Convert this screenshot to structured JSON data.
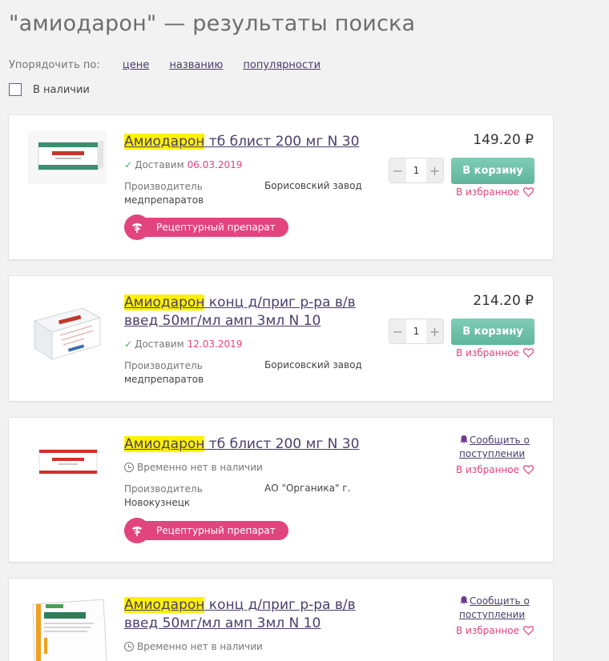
{
  "header": {
    "title": "\"амиодарон\" — результаты поиска"
  },
  "sort": {
    "label": "Упорядочить по:",
    "options": [
      "цене",
      "названию",
      "популярности"
    ]
  },
  "filter": {
    "in_stock_label": "В наличии",
    "in_stock_checked": false
  },
  "colors": {
    "accent": "#e2457e",
    "link": "#4a3d6b",
    "cart_button": "#6cc0a6",
    "highlight": "#fff100"
  },
  "products": [
    {
      "name_highlight": "Амиодарон",
      "name_rest": " тб блист 200 мг N 30",
      "status_text": "Доставим",
      "status_date": "06.03.2019",
      "maker_label": "Производитель",
      "maker_label_cont": "медпрепаратов",
      "maker_value": "Борисовский завод",
      "rx_badge": "Рецептурный препарат",
      "price": "149.20 ₽",
      "quantity": "1",
      "cart_label": "В корзину",
      "favorite_label": "В избранное"
    },
    {
      "name_highlight": "Амиодарон",
      "name_rest": " конц д/приг р-ра в/в введ 50мг/мл амп 3мл N 10",
      "status_text": "Доставим",
      "status_date": "12.03.2019",
      "maker_label": "Производитель",
      "maker_label_cont": "медпрепаратов",
      "maker_value": "Борисовский завод",
      "price": "214.20 ₽",
      "quantity": "1",
      "cart_label": "В корзину",
      "favorite_label": "В избранное"
    },
    {
      "name_highlight": "Амиодарон",
      "name_rest": " тб блист 200 мг N 30",
      "status_text": "Временно нет в наличии",
      "maker_label": "Производитель",
      "maker_label_cont": "Новокузнецк",
      "maker_value": "АО \"Органика\" г.",
      "rx_badge": "Рецептурный препарат",
      "notify_label": "Сообщить о поступлении",
      "favorite_label": "В избранное"
    },
    {
      "name_highlight": "Амиодарон",
      "name_rest": " конц д/приг р-ра в/в введ 50мг/мл амп 3мл N 10",
      "status_text": "Временно нет в наличии",
      "notify_label": "Сообщить о поступлении",
      "favorite_label": "В избранное"
    }
  ]
}
